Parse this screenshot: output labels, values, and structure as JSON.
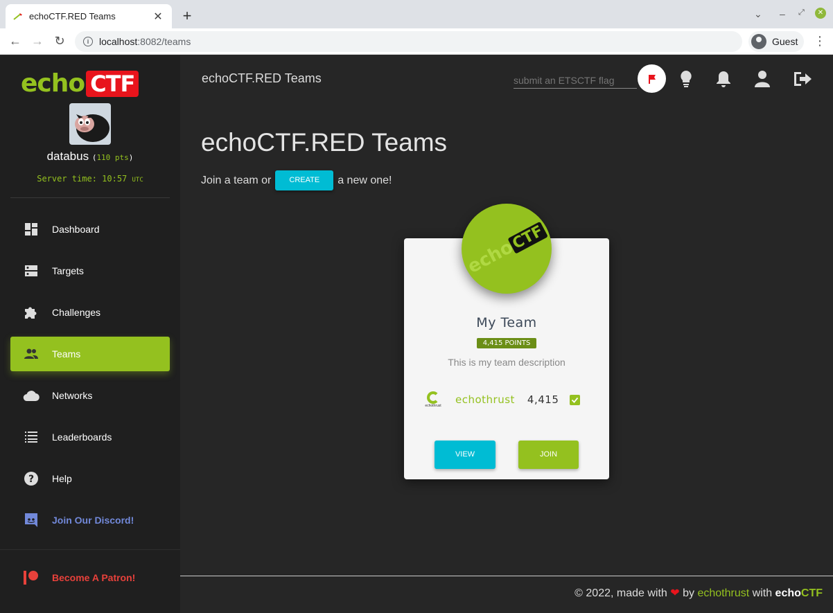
{
  "browser": {
    "tab_title": "echoCTF.RED Teams",
    "url_host": "localhost",
    "url_path": ":8082/teams",
    "profile_label": "Guest"
  },
  "sidebar": {
    "logo_echo": "echo",
    "logo_ctf": "CTF",
    "username": "databus",
    "points_open": "(",
    "points_value": "110 pts",
    "points_close": ")",
    "server_time_label": "Server time: 10:57",
    "server_time_zone": "UTC",
    "items": [
      {
        "label": "Dashboard",
        "icon": "dashboard-icon"
      },
      {
        "label": "Targets",
        "icon": "dns-icon"
      },
      {
        "label": "Challenges",
        "icon": "puzzle-icon"
      },
      {
        "label": "Teams",
        "icon": "people-icon",
        "active": true
      },
      {
        "label": "Networks",
        "icon": "cloud-icon"
      },
      {
        "label": "Leaderboards",
        "icon": "list-icon"
      },
      {
        "label": "Help",
        "icon": "help-icon"
      },
      {
        "label": "Join Our Discord!",
        "icon": "discord-icon"
      }
    ],
    "patron_label": "Become A Patron!"
  },
  "header": {
    "title": "echoCTF.RED Teams",
    "flag_placeholder": "submit an ETSCTF flag"
  },
  "main": {
    "page_title": "echoCTF.RED Teams",
    "join_prefix": "Join a team or",
    "create_label": "CREATE",
    "join_suffix": "a new one!"
  },
  "team_card": {
    "logo_echo": "echo",
    "logo_ctf": "CTF",
    "name": "My Team",
    "points_badge": "4,415 POINTS",
    "description": "This is my team description",
    "members": [
      {
        "name": "echothrust",
        "score": "4,415",
        "avatar_text": "echothrust"
      }
    ],
    "view_label": "VIEW",
    "join_label": "JOIN"
  },
  "footer": {
    "prefix": "© 2022, made with",
    "by": "by",
    "author": "echothrust",
    "with": "with",
    "brand_echo": "echo",
    "brand_ctf": "CTF"
  },
  "colors": {
    "accent_green": "#94c11f",
    "accent_cyan": "#00bcd4",
    "brand_red": "#e8141c",
    "discord": "#7289da",
    "patron": "#e8413b"
  }
}
